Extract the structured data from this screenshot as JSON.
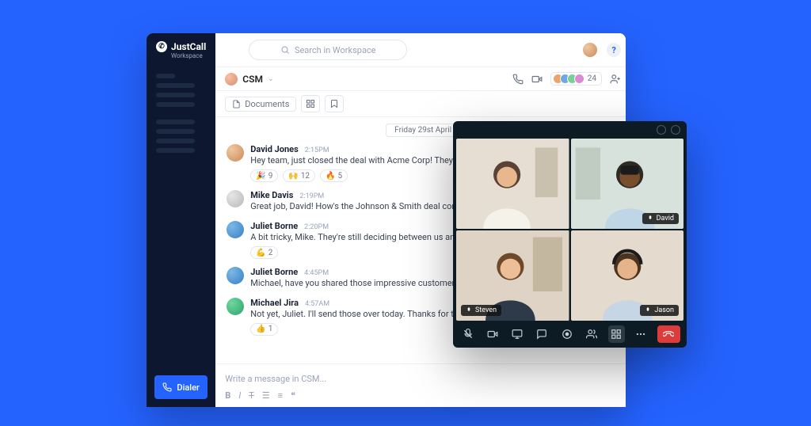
{
  "brand": {
    "name": "JustCall",
    "sub": "Workspace"
  },
  "sidebar": {
    "dialer_label": "Dialer"
  },
  "search": {
    "placeholder": "Search in Workspace"
  },
  "channel": {
    "name": "CSM",
    "members": 24
  },
  "tabs": {
    "documents": "Documents"
  },
  "date_separator": "Friday 29st April",
  "messages": [
    {
      "name": "David Jones",
      "time": "2:15PM",
      "text": "Hey team, just closed the deal with Acme Corp! They loved our product's customization options.",
      "reactions": [
        {
          "e": "🎉",
          "c": 9
        },
        {
          "e": "🙌",
          "c": 12
        },
        {
          "e": "🔥",
          "c": 5
        }
      ]
    },
    {
      "name": "Mike Davis",
      "time": "2:19PM",
      "text": "Great job, David! How's the Johnson & Smith deal coming along?",
      "reactions": []
    },
    {
      "name": "Juliet Borne",
      "time": "2:20PM",
      "text": "A bit tricky, Mike. They're still deciding between us and a competitor.",
      "reactions": [
        {
          "e": "💪",
          "c": 2
        }
      ]
    },
    {
      "name": "Juliet Borne",
      "time": "4:45PM",
      "text": "Michael, have you shared those impressive customer testimonials?",
      "reactions": []
    },
    {
      "name": "Michael Jira",
      "time": "4:57AM",
      "text": "Not yet, Juliet. I'll send those over today. Thanks for the reminder.",
      "reactions": [
        {
          "e": "👍",
          "c": 1
        }
      ]
    }
  ],
  "composer": {
    "placeholder": "Write a message in CSM..."
  },
  "call": {
    "participants": [
      "",
      "David",
      "Steven",
      "Jason"
    ]
  }
}
